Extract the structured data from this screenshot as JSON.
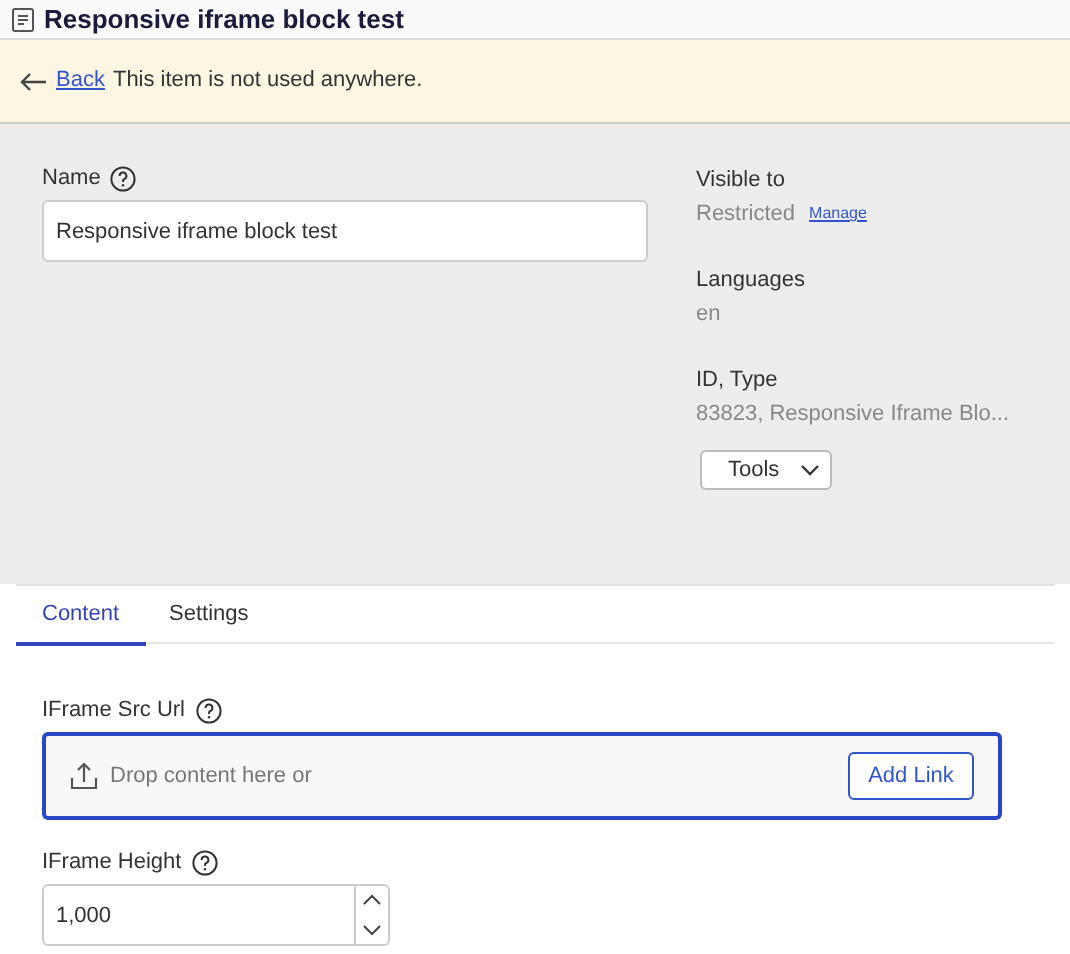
{
  "header": {
    "title": "Responsive iframe block test"
  },
  "banner": {
    "link": "Back",
    "message": "This item is not used anywhere."
  },
  "name_field": {
    "label": "Name",
    "value": "Responsive iframe block test"
  },
  "info": [
    {
      "label": "Visible to",
      "value": "Restricted",
      "link": "Manage"
    },
    {
      "label": "Languages",
      "value": "en"
    },
    {
      "label": "ID, Type",
      "value": "83823, Responsive Iframe Blo..."
    }
  ],
  "tools_button": "Tools",
  "tabs": [
    {
      "label": "Content",
      "selected": true
    },
    {
      "label": "Settings",
      "selected": false
    }
  ],
  "fields": [
    {
      "kind": "drop",
      "label": "IFrame Src Url",
      "placeholder": "Drop content here or",
      "button": "Add Link"
    },
    {
      "kind": "number",
      "label": "IFrame Height",
      "value": "1,000"
    }
  ]
}
